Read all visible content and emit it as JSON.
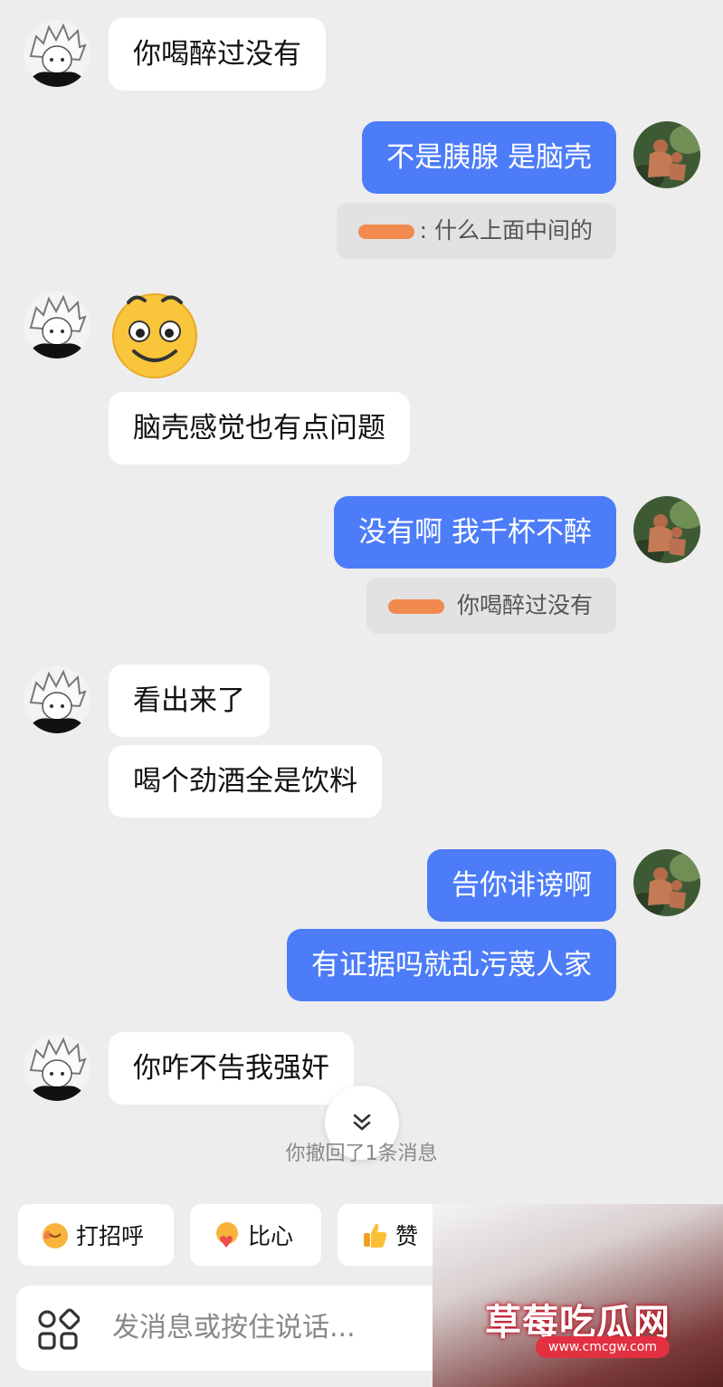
{
  "messages": {
    "m1": "你喝醉过没有",
    "m2": "不是胰腺 是脑壳",
    "m2_quote": ": 什么上面中间的",
    "m3": "脑壳感觉也有点问题",
    "m4": "没有啊 我千杯不醉",
    "m4_quote": " 你喝醉过没有",
    "m5": "看出来了",
    "m6": "喝个劲酒全是饮料",
    "m7": "告你诽谤啊",
    "m8": "有证据吗就乱污蔑人家",
    "m9": "你咋不告我强奸"
  },
  "revoke_notice": "你撤回了1条消息",
  "quick_actions": [
    {
      "label": "打招呼",
      "icon": "wave-hand-icon"
    },
    {
      "label": "比心",
      "icon": "finger-heart-icon"
    },
    {
      "label": "赞",
      "icon": "thumbs-up-icon"
    }
  ],
  "composer": {
    "placeholder": "发消息或按住说话..."
  },
  "watermark": {
    "title": "草莓吃瓜网",
    "url": "www.cmcgw.com"
  },
  "colors": {
    "outgoing_bubble": "#4d7cf8",
    "incoming_bubble": "#ffffff",
    "background": "#ededed"
  }
}
